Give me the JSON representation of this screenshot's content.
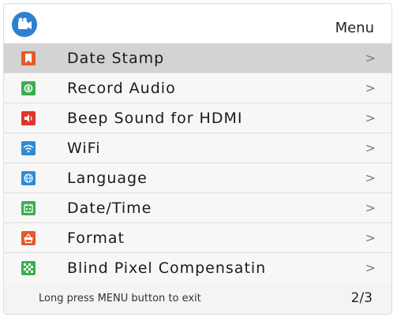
{
  "header": {
    "title": "Menu",
    "app_icon": "camera-icon"
  },
  "items": [
    {
      "label": "Date Stamp",
      "icon": "bookmark-icon",
      "color": "#e8582a",
      "selected": true
    },
    {
      "label": "Record Audio",
      "icon": "audio-record-icon",
      "color": "#3cae4f",
      "selected": false
    },
    {
      "label": "Beep Sound for HDMI",
      "icon": "speaker-icon",
      "color": "#e0352b",
      "selected": false
    },
    {
      "label": "WiFi",
      "icon": "wifi-icon",
      "color": "#2f8bd6",
      "selected": false
    },
    {
      "label": "Language",
      "icon": "globe-icon",
      "color": "#2f8bd6",
      "selected": false
    },
    {
      "label": "Date/Time",
      "icon": "calendar-icon",
      "color": "#3cae4f",
      "selected": false
    },
    {
      "label": "Format",
      "icon": "basket-icon",
      "color": "#e8582a",
      "selected": false
    },
    {
      "label": "Blind Pixel Compensatin",
      "icon": "checkerboard-icon",
      "color": "#3cae4f",
      "selected": false
    }
  ],
  "chevron": ">",
  "footer": {
    "hint": "Long press MENU button to exit",
    "page": "2/3"
  }
}
